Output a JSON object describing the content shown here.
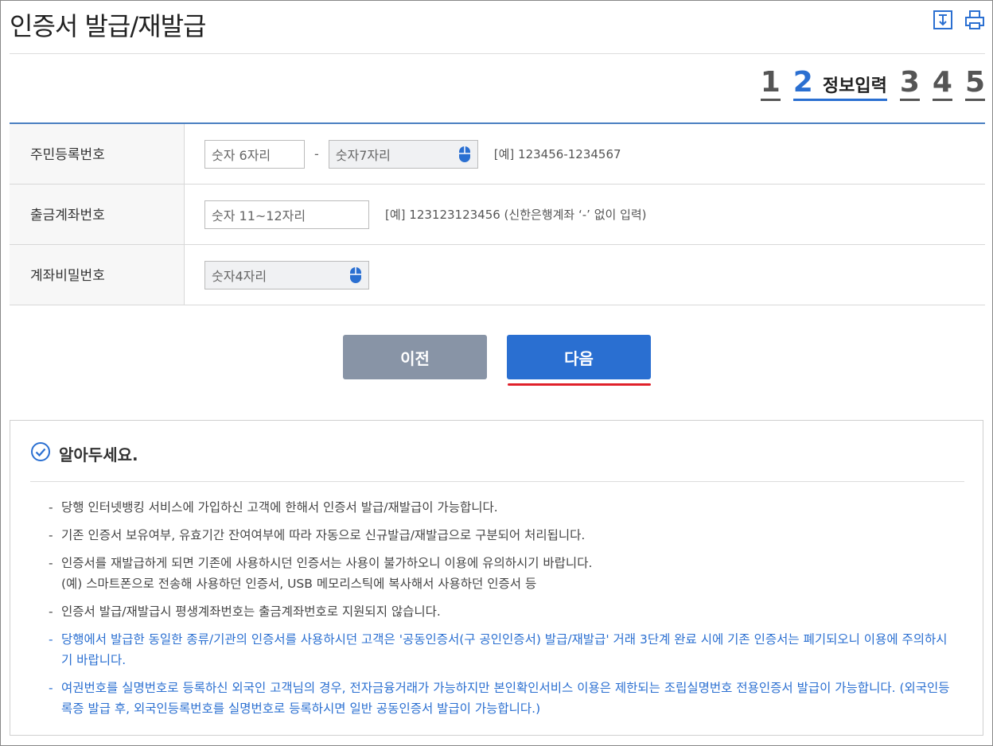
{
  "header": {
    "title": "인증서 발급/재발급",
    "tools": [
      {
        "icon": "resize-icon"
      },
      {
        "icon": "print-icon"
      }
    ]
  },
  "steps": [
    {
      "num": "1"
    },
    {
      "num": "2",
      "label": "정보입력",
      "active": true
    },
    {
      "num": "3"
    },
    {
      "num": "4"
    },
    {
      "num": "5"
    }
  ],
  "form": {
    "rows": [
      {
        "label": "주민등록번호",
        "inputs": [
          {
            "placeholder": "숫자 6자리"
          },
          {
            "placeholder": "숫자7자리"
          }
        ],
        "dash": "-",
        "example": "[예] 123456-1234567"
      },
      {
        "label": "출금계좌번호",
        "inputs": [
          {
            "placeholder": "숫자 11~12자리"
          }
        ],
        "example": "[예] 123123123456 (신한은행계좌 ‘-’ 없이 입력)"
      },
      {
        "label": "계좌비밀번호",
        "inputs": [
          {
            "placeholder": "숫자4자리"
          }
        ]
      }
    ]
  },
  "buttons": {
    "prev": "이전",
    "next": "다음"
  },
  "notice": {
    "title": "알아두세요.",
    "items": [
      {
        "text": "당행 인터넷뱅킹 서비스에 가입하신 고객에 한해서 인증서 발급/재발급이 가능합니다."
      },
      {
        "text": "기존 인증서 보유여부, 유효기간 잔여여부에 따라 자동으로 신규발급/재발급으로 구분되어 처리됩니다."
      },
      {
        "text": "인증서를 재발급하게 되면 기존에 사용하시던 인증서는 사용이 불가하오니 이용에 유의하시기 바랍니다.",
        "sub": "(예) 스마트폰으로 전송해 사용하던 인증서, USB 메모리스틱에 복사해서 사용하던 인증서 등"
      },
      {
        "text": "인증서 발급/재발급시 평생계좌번호는 출금계좌번호로 지원되지 않습니다."
      },
      {
        "text": "당행에서 발급한 동일한 종류/기관의 인증서를 사용하시던 고객은 '공동인증서(구 공인인증서) 발급/재발급' 거래 3단계 완료 시에 기존 인증서는 폐기되오니 이용에 주의하시기 바랍니다.",
        "color": "#2a6fd1"
      },
      {
        "text": "여권번호를 실명번호로 등록하신 외국인 고객님의 경우, 전자금융거래가 가능하지만 본인확인서비스 이용은 제한되는 조립실명번호 전용인증서 발급이 가능합니다. (외국인등록증 발급 후, 외국인등록번호를 실명번호로 등록하시면 일반 공동인증서 발급이 가능합니다.)",
        "color": "#2a6fd1"
      }
    ]
  },
  "colors": {
    "accent": "#2a6fd1",
    "prev_button": "#8894a6",
    "highlight_underline": "#e0202a"
  }
}
